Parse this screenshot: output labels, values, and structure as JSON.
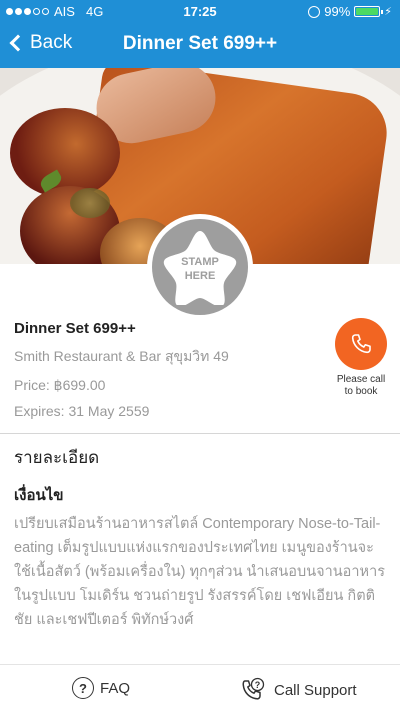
{
  "status_bar": {
    "carrier": "AIS",
    "network": "4G",
    "time": "17:25",
    "battery": "99%",
    "battery_level": 0.99
  },
  "nav": {
    "back_label": "Back",
    "title": "Dinner Set 699++"
  },
  "stamp": {
    "label": "STAMP\nHERE"
  },
  "deal": {
    "title": "Dinner Set 699++",
    "restaurant": "Smith Restaurant & Bar สุขุมวิท 49",
    "price": "Price: ฿699.00",
    "expires": "Expires: 31 May 2559"
  },
  "call": {
    "caption": "Please call to book"
  },
  "details": {
    "heading": "รายละเอียด",
    "subheading": "เงื่อนไข",
    "body": "เปรียบเสมือนร้านอาหารสไตล์ Contemporary Nose-to-Tail-eating เต็มรูปแบบแห่งแรกของประเทศไทย เมนูของร้านจะใช้เนื้อสัตว์ (พร้อมเครื่องใน) ทุกๆส่วน นำเสนอบนจานอาหารในรูปแบบ โมเดิร์น ชวนถ่ายรูป รังสรรค์โดย เชฟเอียน กิตติชัย และเชฟปีเตอร์ พิทักษ์วงศ์"
  },
  "bottom_bar": {
    "faq_label": "FAQ",
    "support_label": "Call Support"
  },
  "colors": {
    "header": "#1f8fd6",
    "call_button": "#f26522",
    "stamp": "#9e9e9e"
  },
  "icons": [
    "back-chevron-icon",
    "phone-icon",
    "star-stamp-icon",
    "question-icon",
    "phone-question-icon",
    "battery-icon"
  ]
}
